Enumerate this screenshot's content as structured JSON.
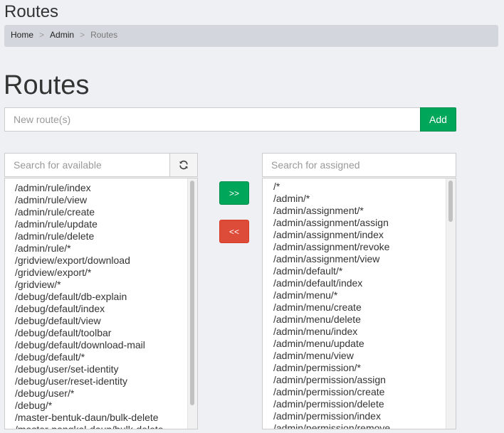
{
  "header": {
    "title": "Routes"
  },
  "breadcrumb": {
    "home": "Home",
    "admin": "Admin",
    "current": "Routes",
    "separator": ">"
  },
  "page": {
    "title": "Routes"
  },
  "new_route": {
    "placeholder": "New route(s)",
    "add_label": "Add"
  },
  "available": {
    "search_placeholder": "Search for available",
    "refresh_icon": "refresh-icon",
    "items": [
      "/admin/rule/index",
      "/admin/rule/view",
      "/admin/rule/create",
      "/admin/rule/update",
      "/admin/rule/delete",
      "/admin/rule/*",
      "/gridview/export/download",
      "/gridview/export/*",
      "/gridview/*",
      "/debug/default/db-explain",
      "/debug/default/index",
      "/debug/default/view",
      "/debug/default/toolbar",
      "/debug/default/download-mail",
      "/debug/default/*",
      "/debug/user/set-identity",
      "/debug/user/reset-identity",
      "/debug/user/*",
      "/debug/*",
      "/master-bentuk-daun/bulk-delete",
      "/master-pangkal-daun/bulk-delete"
    ]
  },
  "controls": {
    "assign_label": ">>",
    "remove_label": "<<"
  },
  "assigned": {
    "search_placeholder": "Search for assigned",
    "items": [
      "/*",
      "/admin/*",
      "/admin/assignment/*",
      "/admin/assignment/assign",
      "/admin/assignment/index",
      "/admin/assignment/revoke",
      "/admin/assignment/view",
      "/admin/default/*",
      "/admin/default/index",
      "/admin/menu/*",
      "/admin/menu/create",
      "/admin/menu/delete",
      "/admin/menu/index",
      "/admin/menu/update",
      "/admin/menu/view",
      "/admin/permission/*",
      "/admin/permission/assign",
      "/admin/permission/create",
      "/admin/permission/delete",
      "/admin/permission/index",
      "/admin/permission/remove"
    ]
  },
  "colors": {
    "success": "#00a65a",
    "danger": "#dd4b39",
    "background": "#eef0f3"
  }
}
